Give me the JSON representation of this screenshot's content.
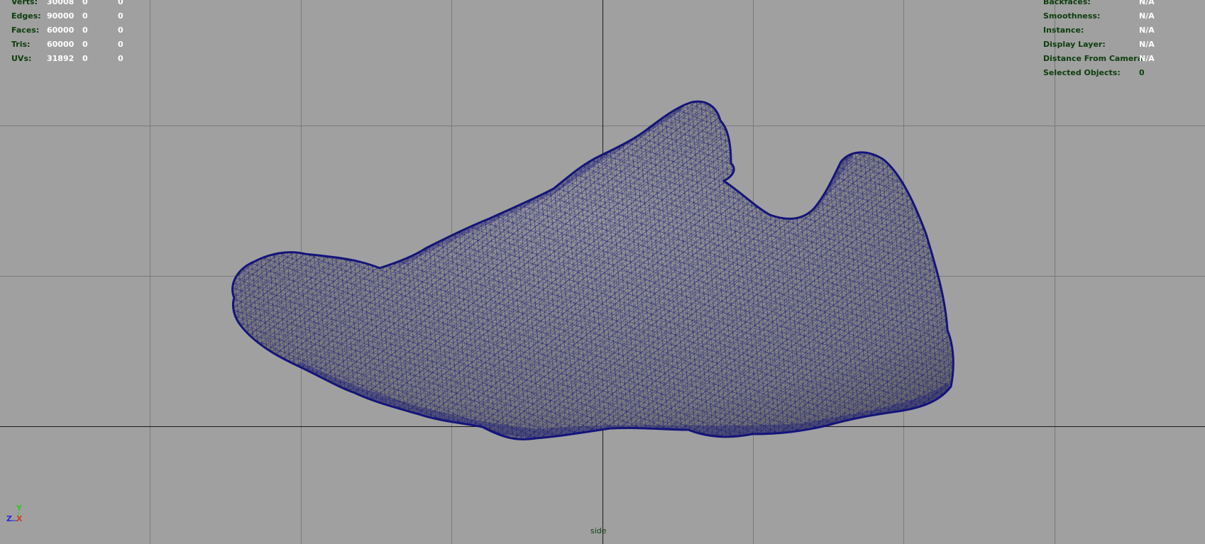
{
  "viewport": {
    "camera_name": "side",
    "background_color": "#a0a0a0",
    "grid_color": "#7a7a7a",
    "axis_line_color": "#1a1a1a",
    "wire_color": "#14147a",
    "shade_color": "#808080"
  },
  "hud_left": {
    "rows": [
      {
        "label": "Verts:",
        "v1": "30008",
        "v2": "0",
        "v3": "0"
      },
      {
        "label": "Edges:",
        "v1": "90000",
        "v2": "0",
        "v3": "0"
      },
      {
        "label": "Faces:",
        "v1": "60000",
        "v2": "0",
        "v3": "0"
      },
      {
        "label": "Tris:",
        "v1": "60000",
        "v2": "0",
        "v3": "0"
      },
      {
        "label": "UVs:",
        "v1": "31892",
        "v2": "0",
        "v3": "0"
      }
    ]
  },
  "hud_right": {
    "rows": [
      {
        "label": "Backfaces:",
        "value": "N/A"
      },
      {
        "label": "Smoothness:",
        "value": "N/A"
      },
      {
        "label": "Instance:",
        "value": "N/A"
      },
      {
        "label": "Display Layer:",
        "value": "N/A"
      },
      {
        "label": "Distance From Camera:",
        "value": "N/A"
      },
      {
        "label": "Selected Objects:",
        "value": "0"
      }
    ]
  },
  "axis_gizmo": {
    "y_label": "Y",
    "z_label": "Z",
    "x_label": "X"
  }
}
